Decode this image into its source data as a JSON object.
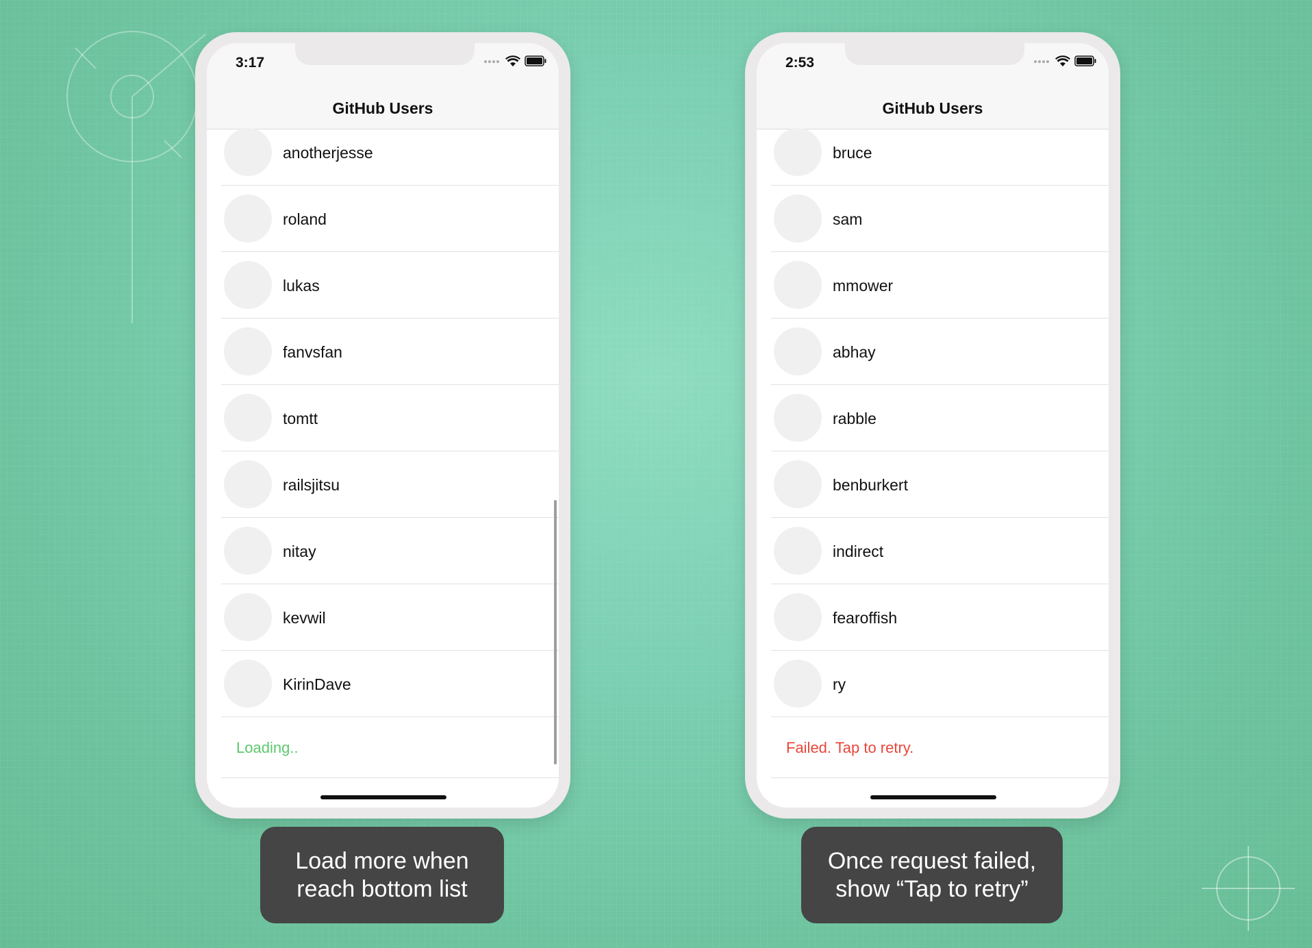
{
  "left_phone": {
    "time": "3:17",
    "title": "GitHub Users",
    "users": [
      "anotherjesse",
      "roland",
      "lukas",
      "fanvsfan",
      "tomtt",
      "railsjitsu",
      "nitay",
      "kevwil",
      "KirinDave"
    ],
    "footer": "Loading..",
    "caption": "Load more when\nreach bottom list"
  },
  "right_phone": {
    "time": "2:53",
    "title": "GitHub Users",
    "users": [
      "bruce",
      "sam",
      "mmower",
      "abhay",
      "rabble",
      "benburkert",
      "indirect",
      "fearoffish",
      "ry"
    ],
    "footer": "Failed. Tap to retry.",
    "caption": "Once request failed,\nshow “Tap to retry”"
  },
  "icons": [
    "cellular-dots-icon",
    "wifi-icon",
    "battery-icon"
  ],
  "colors": {
    "loading": "#5cc86d",
    "failed": "#e8463a",
    "caption_bg": "#454545",
    "background": "#7cd0b4"
  }
}
